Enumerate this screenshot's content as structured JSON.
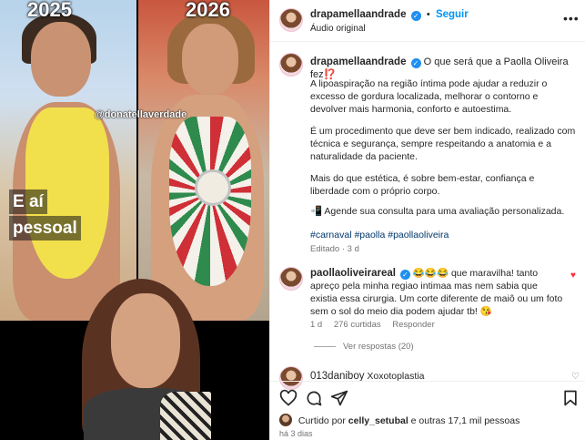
{
  "media": {
    "year_left": "2025",
    "year_right": "2026",
    "watermark": "@donatellaverdade",
    "caption_lines": [
      "E aí",
      "pessoal"
    ]
  },
  "header": {
    "username": "drapamellaandrade",
    "follow_label": "Seguir",
    "audio_label": "Áudio original"
  },
  "post": {
    "username": "drapamellaandrade",
    "caption_first": "O que será que a Paolla Oliveira fez⁉️",
    "paragraphs": [
      "A lipoaspiração na região íntima pode ajudar a reduzir o excesso de gordura localizada, melhorar o contorno e devolver mais harmonia, conforto e autoestima.",
      "É um procedimento que deve ser bem indicado, realizado com técnica e segurança, sempre respeitando a anatomia e a naturalidade da paciente.",
      "Mais do que estética, é sobre bem-estar, confiança e liberdade com o próprio corpo.",
      "📲 Agende sua consulta para uma avaliação personalizada."
    ],
    "hashtags": "#carnaval #paolla #paollaoliveira",
    "edited": "Editado · 3 d"
  },
  "comments": [
    {
      "username": "paollaoliveirareal",
      "text": "😂😂😂 que maravilha! tanto apreço pela minha regiao intimaa mas nem sabia que existia essa cirurgia. Um corte diferente de maiô ou um foto sem o sol do meio dia podem ajudar tb! 😘",
      "age": "1 d",
      "likes": "276 curtidas",
      "reply_label": "Responder",
      "view_replies": "Ver respostas (20)"
    },
    {
      "username": "013daniboy",
      "text": "Xoxotoplastia"
    }
  ],
  "footer": {
    "liked_by_prefix": "Curtido por",
    "liked_by_user": "celly_setubal",
    "liked_by_suffix": "e outras 17,1 mil pessoas",
    "time_ago": "há 3 dias"
  },
  "icons": {
    "like": "heart-icon",
    "comment": "comment-icon",
    "share": "share-icon",
    "save": "bookmark-icon",
    "verified": "verified-badge-icon",
    "more": "more-options-icon"
  },
  "colors": {
    "link": "#0095f6",
    "hashtag": "#00376b",
    "muted": "#737373",
    "liked_heart": "#ff3040"
  }
}
